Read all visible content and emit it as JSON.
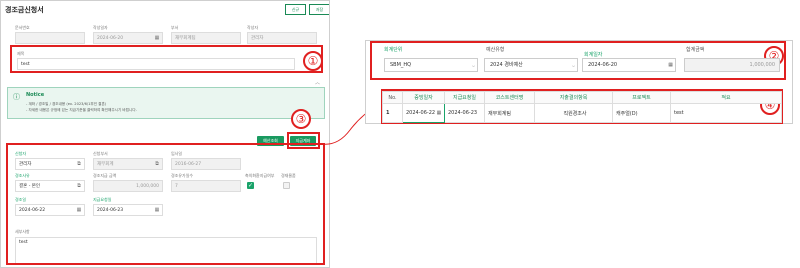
{
  "left_form": {
    "title": "경조금신청서",
    "header_buttons": [
      {
        "label": "신규"
      },
      {
        "label": "저장"
      }
    ],
    "row1": {
      "labels": [
        "문서번호",
        "작성일자",
        "부서",
        "작성자"
      ],
      "values": [
        "",
        "2024-06-20",
        "재무회계팀",
        "관리자"
      ]
    },
    "subject": {
      "label": "제목",
      "value": "test"
    },
    "notice": {
      "title": "Notice",
      "lines": [
        "- 계좌 / 경조일 / 경조내용 (ex. 2023/6/1부인 결혼)",
        "- 자세한 내용은 규정에 있는 지급기준을 클릭하여 확인해주시기 바랍니다."
      ]
    },
    "action_buttons": {
      "budget_check": "예산조회",
      "select_account": "지급계좌"
    },
    "row2": {
      "labels": [
        "신청자",
        "신청부서",
        "입사일"
      ],
      "values": [
        "관리자",
        "재무회계",
        "2016-06-27"
      ]
    },
    "row3": {
      "labels": [
        "경조사유",
        "경조지급 금액",
        "경조유가일수",
        "축의화환지급여부",
        "경재물품"
      ],
      "values": [
        "결혼 - 본인",
        "1,000,000",
        "7"
      ]
    },
    "row4": {
      "labels": [
        "경조일",
        "지급요청일"
      ],
      "values": [
        "2024-06-22",
        "2024-06-23"
      ]
    },
    "remark": {
      "label": "세부사항",
      "value": "test"
    },
    "markers": [
      "①",
      "③"
    ]
  },
  "right_panel": {
    "labels": {
      "accounting_unit": "회계단위",
      "budget_type": "예산유형",
      "accounting_date": "회계일자",
      "total_amount": "합계금액"
    },
    "values": {
      "accounting_unit": "SBM_HQ",
      "budget_type": "2024 경비예산",
      "accounting_date": "2024-06-20",
      "total_amount": "1,000,000"
    },
    "grid": {
      "columns": [
        "No.",
        "증빙일자",
        "지급요청일",
        "코스트센터명",
        "지출결의항목",
        "프로젝트",
        "적요"
      ],
      "rows": [
        [
          "1",
          "2024-06-22",
          "2024-06-23",
          "재무회계팀",
          "직원경조사",
          "캐주얼(D)",
          "test"
        ]
      ]
    },
    "markers": [
      "②",
      "④"
    ]
  },
  "colors": {
    "accent": "#1a9a60",
    "annotation": "#e02020"
  }
}
